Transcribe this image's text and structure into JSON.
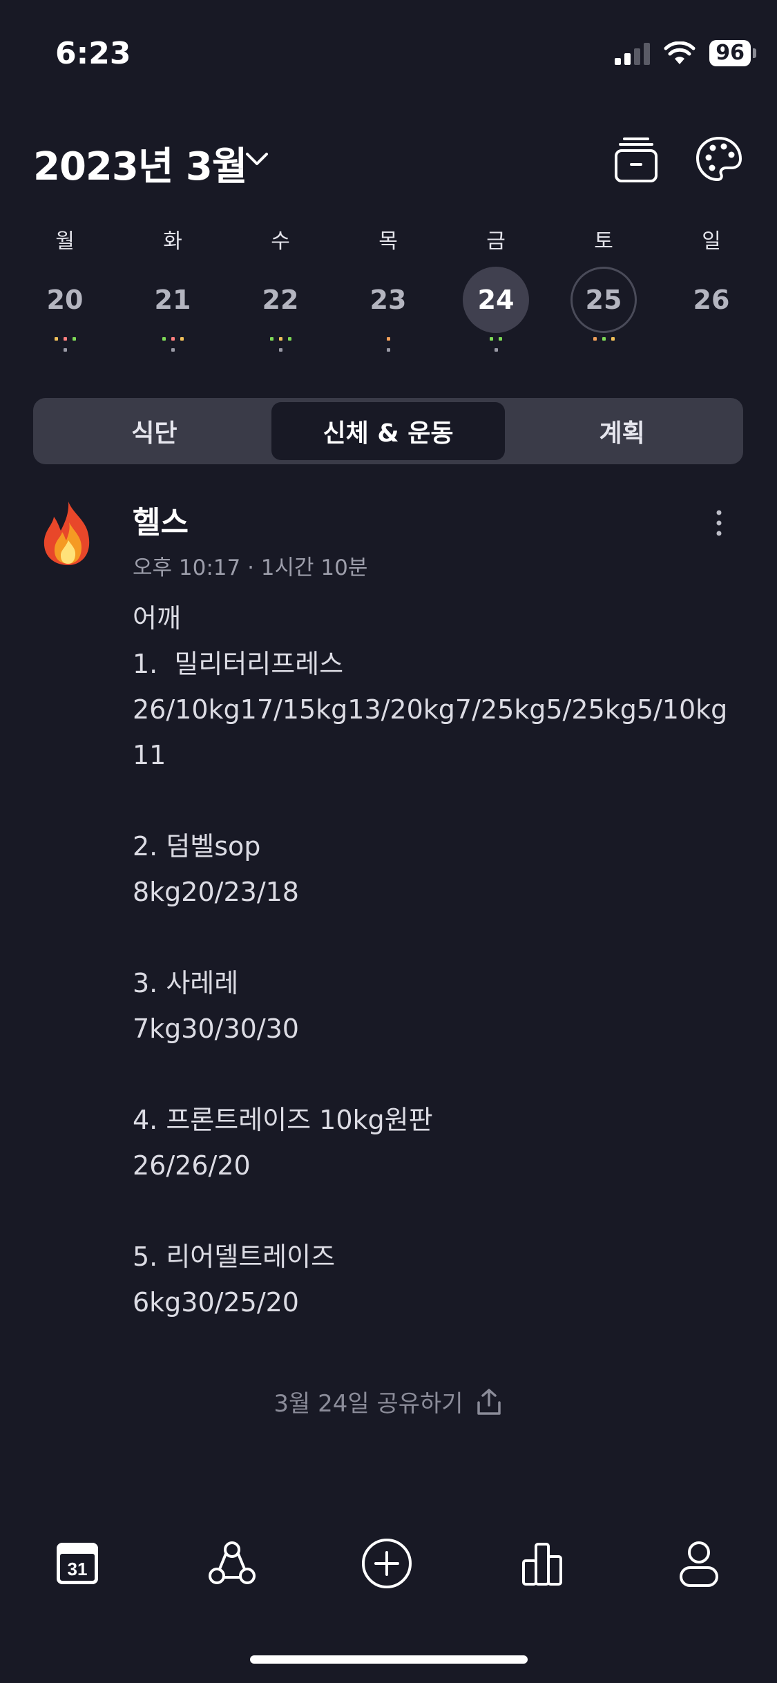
{
  "status_bar": {
    "time": "6:23",
    "battery": "96"
  },
  "header": {
    "month_title": "2023년 3월"
  },
  "week": [
    {
      "name": "월",
      "date": "20",
      "dots": [
        "#f0c05a",
        "#ff7f7f",
        "#7ed957"
      ]
    },
    {
      "name": "화",
      "date": "21",
      "dots": [
        "#7ed957",
        "#ff7f7f",
        "#f0c05a"
      ]
    },
    {
      "name": "수",
      "date": "22",
      "dots": [
        "#7ed957",
        "#f0c05a",
        "#7ed957"
      ]
    },
    {
      "name": "목",
      "date": "23",
      "dots": [
        "#f0a05a"
      ]
    },
    {
      "name": "금",
      "date": "24",
      "dots": [
        "#7ed957",
        "#7ed957"
      ]
    },
    {
      "name": "토",
      "date": "25",
      "dots": [
        "#f0a05a",
        "#7ed957",
        "#f0c05a"
      ]
    },
    {
      "name": "일",
      "date": "26",
      "dots": []
    }
  ],
  "tabs": [
    {
      "label": "식단"
    },
    {
      "label": "신체 & 운동"
    },
    {
      "label": "계획"
    }
  ],
  "entry": {
    "title": "헬스",
    "meta": "오후 10:17 · 1시간 10분",
    "body": "어깨\n1.  밀리터리프레스\n26/10kg17/15kg13/20kg7/25kg5/25kg5/10kg11\n\n2. 덤벨sop\n8kg20/23/18\n\n3. 사레레\n7kg30/30/30\n\n4. 프론트레이즈 10kg원판\n26/26/20\n\n5. 리어델트레이즈\n6kg30/25/20"
  },
  "share": {
    "label": "3월 24일 공유하기"
  },
  "bottom_nav": {
    "calendar_day": "31"
  },
  "colors": {
    "background": "#181925",
    "selected_day": "#40404f",
    "tab_bar": "#3a3b48"
  }
}
